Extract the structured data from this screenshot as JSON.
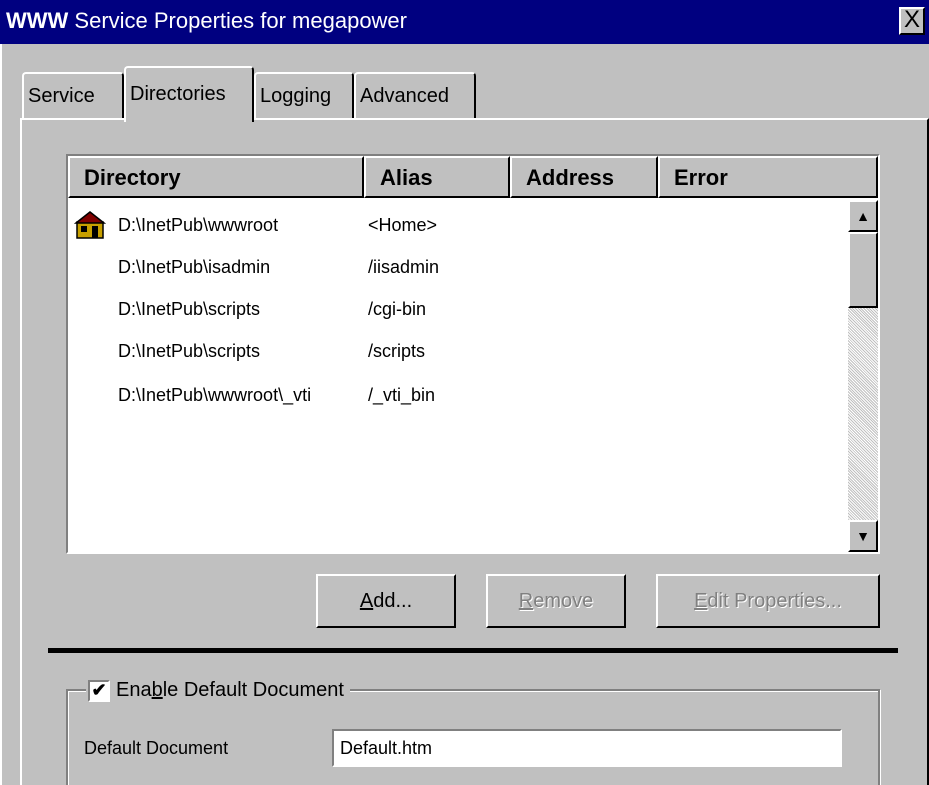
{
  "window": {
    "title_prefix": "WWW",
    "title_rest": " Service Properties for megapower",
    "close_glyph": "X"
  },
  "tabs": [
    {
      "label": "Service"
    },
    {
      "label": "Directories"
    },
    {
      "label": "Logging"
    },
    {
      "label": "Advanced"
    }
  ],
  "list": {
    "columns": [
      "Directory",
      "Alias",
      "Address",
      "Error"
    ],
    "rows": [
      {
        "directory": "D:\\InetPub\\wwwroot",
        "alias": "<Home>",
        "icon": "home-folder-icon"
      },
      {
        "directory": "D:\\InetPub\\isadmin",
        "alias": "/iisadmin"
      },
      {
        "directory": "D:\\InetPub\\scripts",
        "alias": "/cgi-bin"
      },
      {
        "directory": "D:\\InetPub\\scripts",
        "alias": "/scripts"
      },
      {
        "directory": "D:\\InetPub\\wwwroot\\_vti",
        "alias": "/_vti_bin"
      }
    ]
  },
  "buttons": {
    "add": {
      "label_first": "A",
      "label_rest": "dd..."
    },
    "remove": {
      "label_first": "R",
      "label_rest": "emove"
    },
    "edit": {
      "label_first": "E",
      "label_rest": "dit Properties..."
    }
  },
  "default_doc": {
    "checkbox_label_before": "Ena",
    "checkbox_label_u": "b",
    "checkbox_label_after": "le Default Document",
    "checked": true,
    "field_label": "Default Document",
    "field_value": "Default.htm"
  }
}
